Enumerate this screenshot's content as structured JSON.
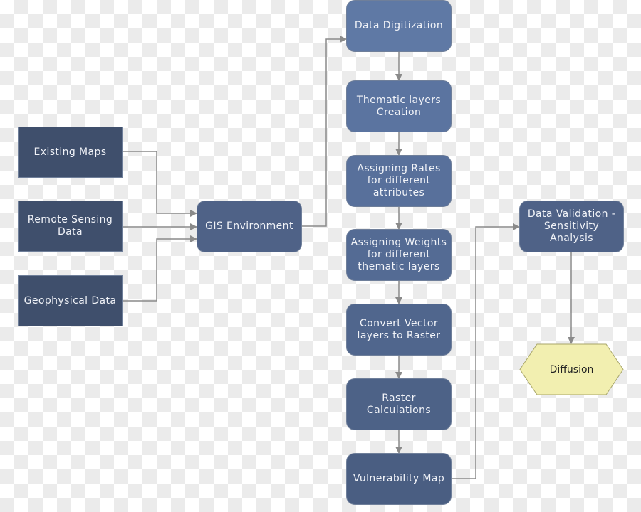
{
  "inputs": [
    {
      "label": "Existing Maps"
    },
    {
      "label": "Remote Sensing Data"
    },
    {
      "label": "Geophysical Data"
    }
  ],
  "gis": {
    "label": "GIS Environment"
  },
  "steps": [
    {
      "label": "Data Digitization"
    },
    {
      "label": "Thematic layers Creation"
    },
    {
      "label": "Assigning Rates for different attributes"
    },
    {
      "label": "Assigning Weights for different thematic layers"
    },
    {
      "label": "Convert Vector layers to Raster"
    },
    {
      "label": "Raster Calculations"
    },
    {
      "label": "Vulnerability Map"
    }
  ],
  "validation": {
    "label": "Data Validation - Sensitivity Analysis"
  },
  "output": {
    "label": "Diffusion"
  },
  "colors": {
    "input_box": "#3f4f6c",
    "process_box": "#4d6186",
    "terminal_fill": "#f2efb0",
    "connector": "#8a8a8a"
  }
}
